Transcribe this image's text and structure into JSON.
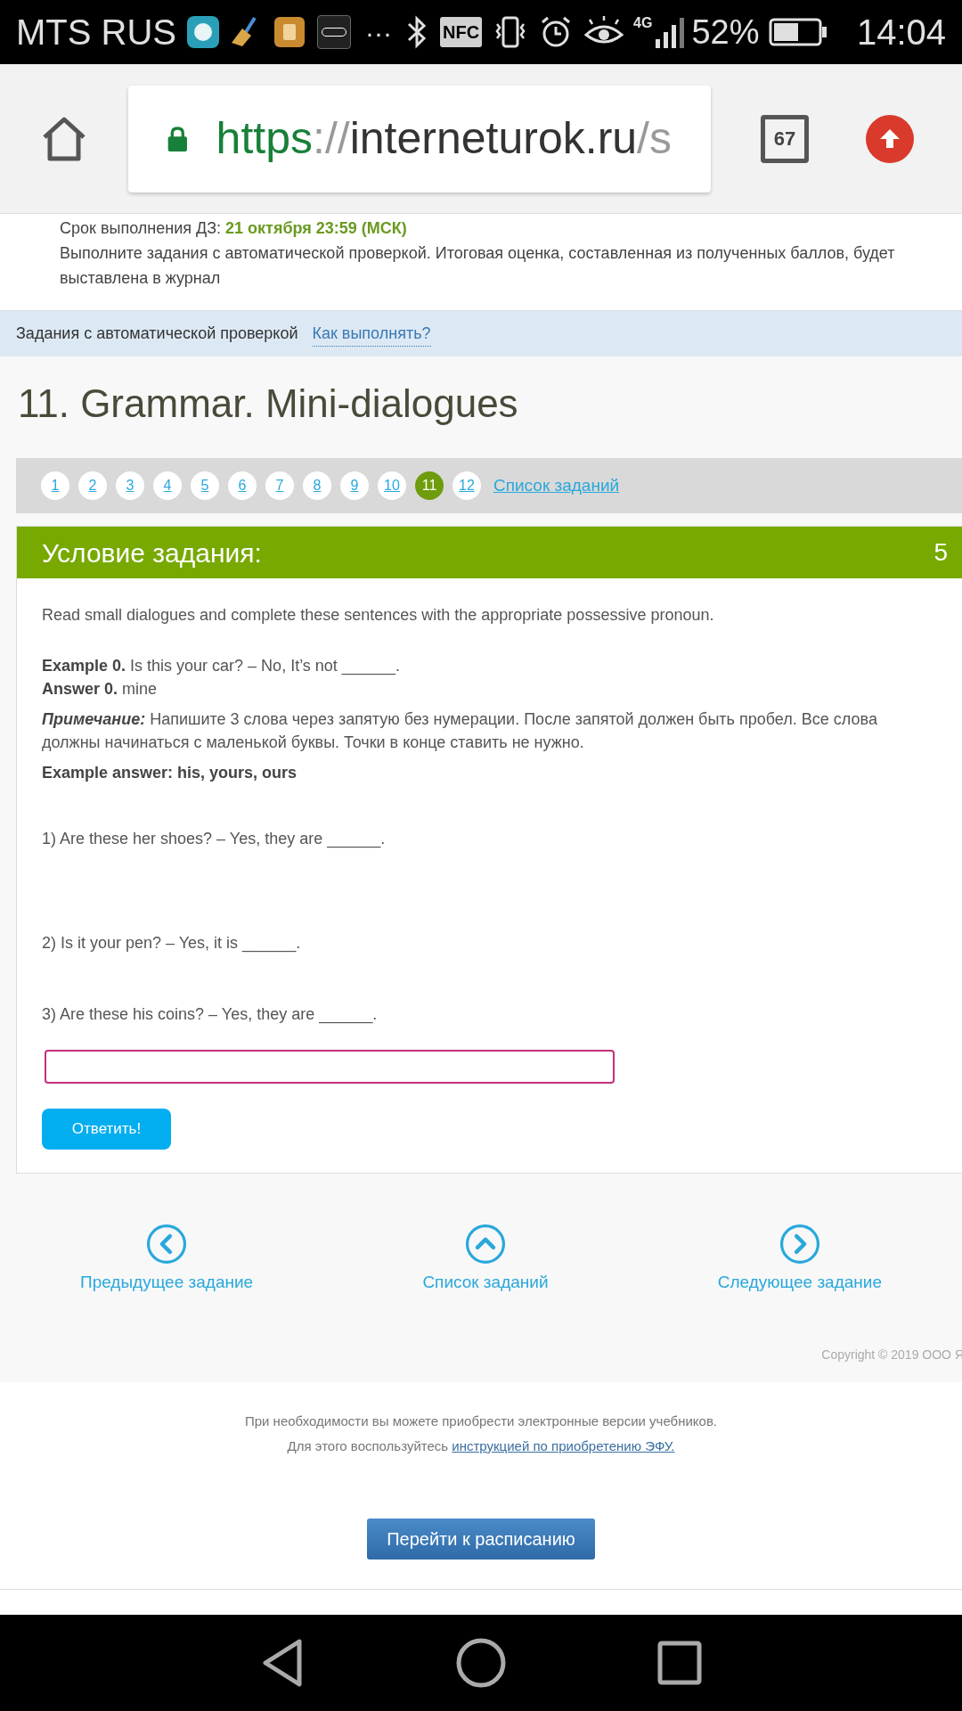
{
  "status_bar": {
    "carrier": "MTS RUS",
    "more": "···",
    "nfc": "NFC",
    "network": "4G",
    "battery": "52%",
    "time": "14:04"
  },
  "browser": {
    "url": {
      "scheme": "https",
      "separator": "://",
      "host": "interneturok.ru",
      "path": "/s"
    },
    "tabs_count": "67"
  },
  "deadline": {
    "label": "Срок выполнения ДЗ:",
    "value": "21 октября 23:59 (МСК)",
    "text": "Выполните задания с автоматической проверкой. Итоговая оценка, составленная из полученных баллов, будет выставлена в журнал"
  },
  "section_bar": {
    "label": "Задания с автоматической проверкой",
    "link": "Как выполнять?"
  },
  "title": "11. Grammar. Mini-dialogues",
  "pagination": {
    "pages": [
      {
        "label": "1",
        "selected": false
      },
      {
        "label": "2",
        "selected": false
      },
      {
        "label": "3",
        "selected": false
      },
      {
        "label": "4",
        "selected": false
      },
      {
        "label": "5",
        "selected": false
      },
      {
        "label": "6",
        "selected": false
      },
      {
        "label": "7",
        "selected": false
      },
      {
        "label": "8",
        "selected": false
      },
      {
        "label": "9",
        "selected": false
      },
      {
        "label": "10",
        "selected": false
      },
      {
        "label": "11",
        "selected": true
      },
      {
        "label": "12",
        "selected": false
      }
    ],
    "list_link": "Список заданий"
  },
  "task": {
    "header": "Условие задания:",
    "score": "5",
    "paragraphs": [
      {
        "kind": "intro",
        "text": "Read small dialogues and complete these sentences with the appropriate possessive pronoun."
      },
      {
        "kind": "example",
        "text": "**Example 0.** Is this your car? – No, It’s not ______."
      },
      {
        "kind": "answer",
        "text": "**Answer 0.** mine"
      },
      {
        "kind": "note",
        "text": "**Примечание:** Напишите 3 слова через запятую без нумерации. После запятой должен быть пробел. Все слова должны начинаться с маленькой буквы. Точки в конце ставить не нужно."
      },
      {
        "kind": "bold",
        "text": "Example answer: his, yours, ours"
      }
    ],
    "questions": [
      "1) Are these her shoes? – Yes, they are ______.",
      "2) Is it your pen? – Yes, it is ______.",
      "3) Are these his coins? – Yes, they are ______."
    ],
    "answer_button": "Ответить!"
  },
  "navigation": [
    {
      "kind": "prev",
      "label": "Предыдущее задание"
    },
    {
      "kind": "up",
      "label": "Список заданий"
    },
    {
      "kind": "next",
      "label": "Следующее задание"
    }
  ],
  "copyright": "Copyright © 2019 ООО Я",
  "footer": {
    "line1": "При необходимости вы можете приобрести электронные версии учебников.",
    "line2": "Для этого воспользуйтесь",
    "link": "инструкцией по приобретению ЭФУ."
  },
  "schedule_button": "Перейти к расписанию"
}
